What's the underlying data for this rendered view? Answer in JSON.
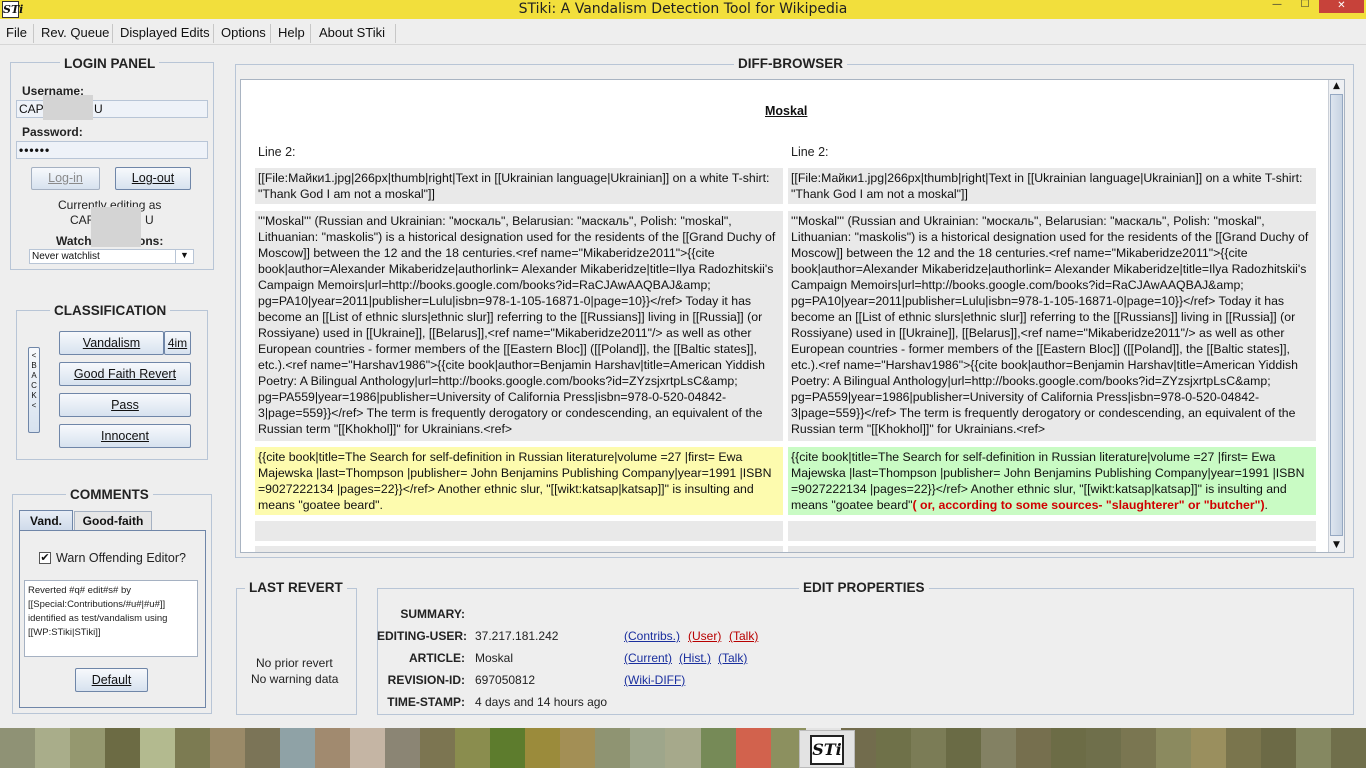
{
  "window": {
    "title": "STiki: A Vandalism Detection Tool for Wikipedia",
    "app_icon": "STi",
    "controls": {
      "minimize": "—",
      "maximize": "☐",
      "close": "✕"
    }
  },
  "menu": [
    "File",
    "Rev. Queue",
    "Displayed Edits",
    "Options",
    "Help",
    "About STiki"
  ],
  "login": {
    "title": "LOGIN PANEL",
    "username_label": "Username:",
    "username_value": "CAP",
    "username_value_end": "U",
    "password_label": "Password:",
    "password_value": "••••••",
    "login_button": "Log-in",
    "logout_button": "Log-out",
    "editing_as_line1": "Currently editing as",
    "editing_as_name": "CAF",
    "editing_as_name_end": "U",
    "watch_label_start": "Watch",
    "watch_label_end": "ons:",
    "watch_select": "Never watchlist"
  },
  "classification": {
    "title": "CLASSIFICATION",
    "back": [
      "<",
      "B",
      "A",
      "C",
      "K",
      "<"
    ],
    "vandalism": "Vandalism",
    "vandalism_shortcut": "4im",
    "good_faith": "Good Faith Revert",
    "pass": "Pass",
    "innocent": "Innocent"
  },
  "comments": {
    "title": "COMMENTS",
    "tabs": [
      "Vand.",
      "Good-faith"
    ],
    "warn_label": "Warn Offending Editor?",
    "warn_checked": true,
    "comment_text": "Reverted #q# edit#s# by [[Special:Contributions/#u#|#u#]] identified as test/vandalism using [[WP:STiki|STiki]]",
    "default_button": "Default"
  },
  "diff": {
    "title": "DIFF-BROWSER",
    "article": "Moskal",
    "left_line": "Line 2:",
    "right_line": "Line 2:",
    "ctx1": "[[File:Майки1.jpg|266px|thumb|right|Text in [[Ukrainian language|Ukrainian]] on a white T-shirt: \"Thank God I am not a moskal\"]]",
    "ctx2": "'''Moskal''' (Russian and Ukrainian: \"москаль\", Belarusian: \"маскаль\", Polish: \"moskal\", Lithuanian: \"maskolis\") is a historical designation used for the residents of the [[Grand Duchy of Moscow]] between the 12 and the 18 centuries.<ref name=\"Mikaberidze2011\">{{cite book|author=Alexander Mikaberidze|authorlink= Alexander Mikaberidze|title=Ilya Radozhitskii's Campaign Memoirs|url=http://books.google.com/books?id=RaCJAwAAQBAJ&amp; pg=PA10|year=2011|publisher=Lulu|isbn=978-1-105-16871-0|page=10}}</ref> Today it has become an [[List of ethnic slurs|ethnic slur]] referring to the [[Russians]] living in [[Russia]] (or Rossiyane) used in [[Ukraine]], [[Belarus]],<ref name=\"Mikaberidze2011\"/> as well as other European countries - former members of the [[Eastern Bloc]] ([[Poland]], the [[Baltic states]], etc.).<ref name=\"Harshav1986\">{{cite book|author=Benjamin Harshav|title=American Yiddish Poetry: A Bilingual Anthology|url=http://books.google.com/books?id=ZYzsjxrtpLsC&amp; pg=PA559|year=1986|publisher=University of California Press|isbn=978-0-520-04842-3|page=559}}</ref> The term is frequently derogatory or condescending, an equivalent of the Russian term \"[[Khokhol]]\" for Ukrainians.<ref>",
    "changed": "{{cite book|title=The Search for self-definition in Russian literature|volume =27 |first= Ewa Majewska |last=Thompson |publisher= John Benjamins Publishing Company|year=1991 |ISBN =9027222134 |pages=22}}</ref> Another ethnic slur, \"[[wikt:katsap|katsap]]\" is insulting and means \"goatee beard\".",
    "changed_new_prefix": "{{cite book|title=The Search for self-definition in Russian literature|volume =27 |first= Ewa Majewska |last=Thompson |publisher= John Benjamins Publishing Company|year=1991 |ISBN =9027222134 |pages=22}}</ref> Another ethnic slur, \"[[wikt:katsap|katsap]]\" is insulting and means \"goatee beard\"",
    "changed_new_insert": "( or, according to some sources- \"slaughterer\" or \"butcher\")",
    "changed_new_suffix": "."
  },
  "last_revert": {
    "title": "LAST REVERT",
    "line1": "No prior revert",
    "line2": "No warning data"
  },
  "edit_props": {
    "title": "EDIT PROPERTIES",
    "summary_label": "SUMMARY:",
    "summary_value": "",
    "user_label": "EDITING-USER:",
    "user_value": "37.217.181.242",
    "user_links": [
      "(Contribs.)",
      "(User)",
      "(Talk)"
    ],
    "article_label": "ARTICLE:",
    "article_value": "Moskal",
    "article_links": [
      "(Current)",
      "(Hist.)",
      "(Talk)"
    ],
    "rev_label": "REVISION-ID:",
    "rev_value": "697050812",
    "rev_link": "(Wiki-DIFF)",
    "time_label": "TIME-STAMP:",
    "time_value": "4 days and 14 hours ago"
  },
  "taskbar": {
    "active_icon": "STi",
    "colors": [
      "#8f9275",
      "#a9ad8a",
      "#95986f",
      "#6c6b44",
      "#b3ba8f",
      "#7c7b52",
      "#9a8a68",
      "#7b7457",
      "#8fa2a6",
      "#a18a6f",
      "#c5b5a4",
      "#8b8574",
      "#7c7551",
      "#8a8d4e",
      "#5d7c2d",
      "#9b8b3b",
      "#a38f55",
      "#8f9472",
      "#9ea68b",
      "#a6a98b",
      "#768a57",
      "#d2624d",
      "#8c905f",
      "#e3e3e3",
      "#726c4d",
      "#6f7149",
      "#7b7c56",
      "#6a6b45",
      "#838163",
      "#766f4e",
      "#6c6c46",
      "#6f6f4b",
      "#7a7651",
      "#8b8a5f",
      "#9a8f5e",
      "#7a754d",
      "#6c6a46",
      "#858861",
      "#706f4b"
    ]
  }
}
